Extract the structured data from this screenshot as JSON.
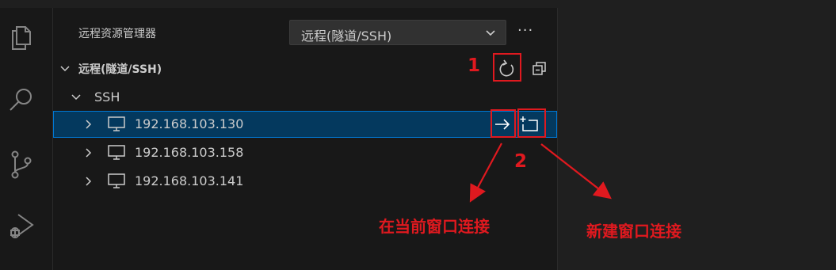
{
  "explorer": {
    "title": "远程资源管理器",
    "selector_value": "远程(隧道/SSH)",
    "more_label": "···"
  },
  "tree": {
    "section_label": "远程(隧道/SSH)",
    "group_label": "SSH",
    "hosts": [
      {
        "label": "192.168.103.130",
        "selected": true
      },
      {
        "label": "192.168.103.158",
        "selected": false
      },
      {
        "label": "192.168.103.141",
        "selected": false
      }
    ]
  },
  "annotations": {
    "num1": "1",
    "num2": "2",
    "connect_current": "在当前窗口连接",
    "connect_new": "新建窗口连接"
  },
  "colors": {
    "accent_red": "#e0191f",
    "selection_bg": "#04395e",
    "selection_border": "#0078d4"
  },
  "icons": {
    "activity": [
      "files-icon",
      "search-icon",
      "source-control-icon",
      "run-debug-icon"
    ],
    "toolbar": [
      "refresh-icon",
      "collapse-all-icon",
      "connect-in-current-window-icon",
      "connect-in-new-window-icon"
    ],
    "host": "monitor-icon"
  }
}
